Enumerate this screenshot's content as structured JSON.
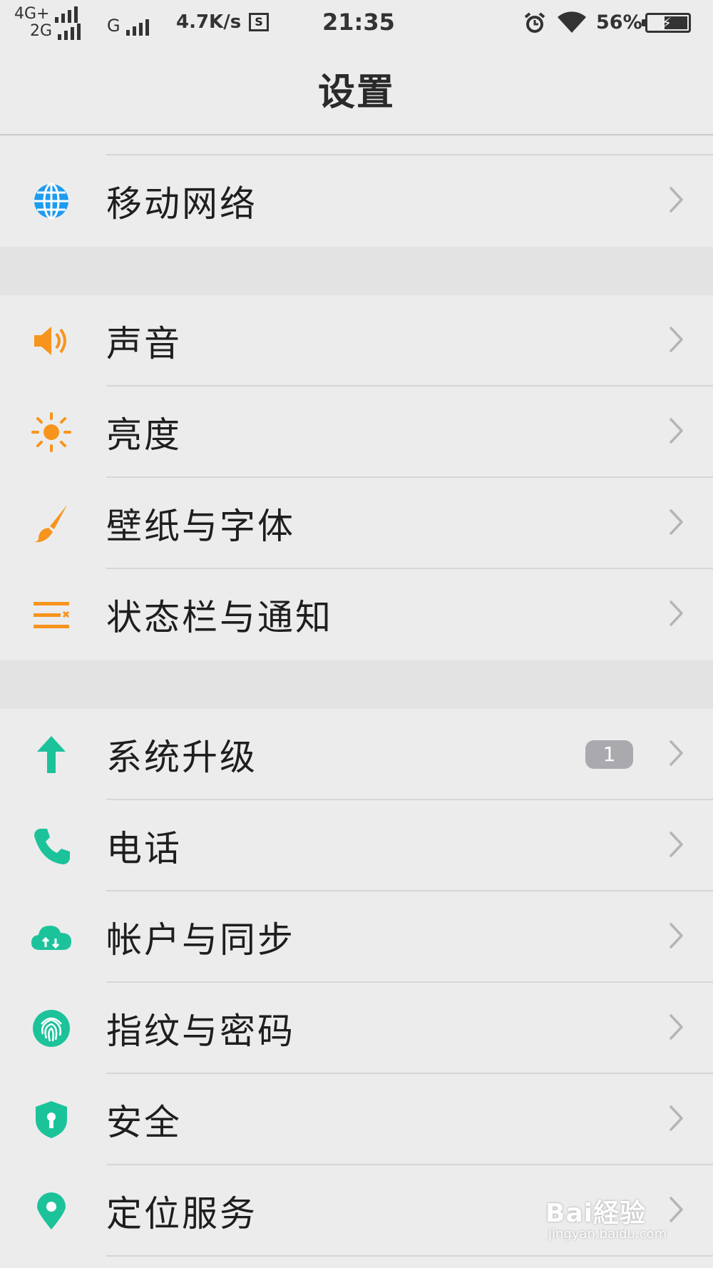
{
  "status_bar": {
    "net_primary": "4G+",
    "net_secondary": "2G",
    "net_third": "G",
    "speed": "4.7K/s",
    "box_glyph": "S",
    "time": "21:35",
    "battery_percent": "56%",
    "battery_level": 0.56
  },
  "header": {
    "title": "设置"
  },
  "groups": [
    {
      "items": [
        {
          "label": "移动网络",
          "icon": "globe-icon",
          "color": "#1E9BEF"
        }
      ]
    },
    {
      "items": [
        {
          "label": "声音",
          "icon": "speaker-icon",
          "color": "#F7941D"
        },
        {
          "label": "亮度",
          "icon": "sun-icon",
          "color": "#F7941D"
        },
        {
          "label": "壁纸与字体",
          "icon": "brush-icon",
          "color": "#F7941D"
        },
        {
          "label": "状态栏与通知",
          "icon": "statusbar-list-icon",
          "color": "#F7941D"
        }
      ]
    },
    {
      "items": [
        {
          "label": "系统升级",
          "icon": "arrow-up-icon",
          "color": "#1CC39A",
          "badge": "1"
        },
        {
          "label": "电话",
          "icon": "phone-icon",
          "color": "#1CC39A"
        },
        {
          "label": "帐户与同步",
          "icon": "cloud-sync-icon",
          "color": "#1CC39A"
        },
        {
          "label": "指纹与密码",
          "icon": "fingerprint-icon",
          "color": "#1CC39A"
        },
        {
          "label": "安全",
          "icon": "shield-icon",
          "color": "#1CC39A"
        },
        {
          "label": "定位服务",
          "icon": "location-pin-icon",
          "color": "#1CC39A"
        }
      ]
    }
  ],
  "watermark": {
    "logo": "Bai経验",
    "url": "jingyan.baidu.com"
  }
}
